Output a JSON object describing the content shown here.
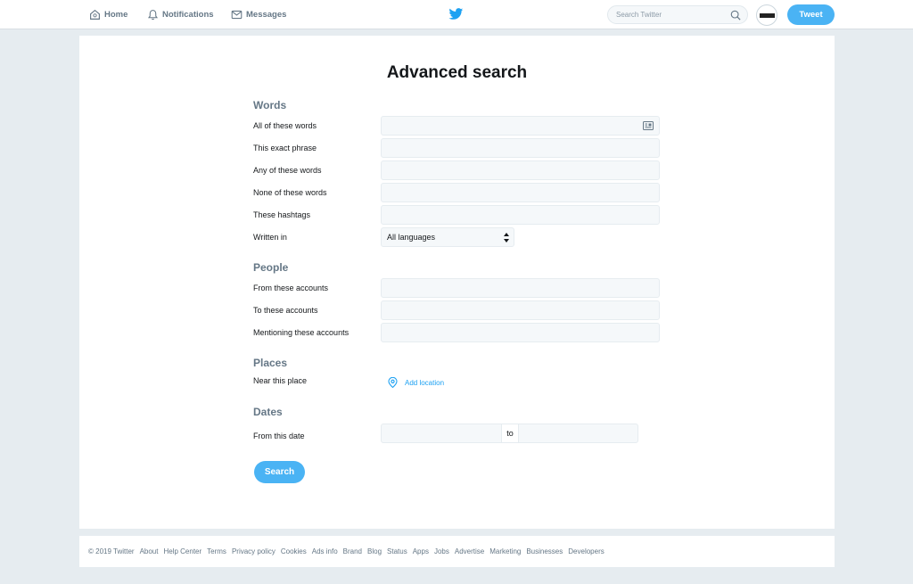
{
  "nav": {
    "home_label": "Home",
    "notifications_label": "Notifications",
    "messages_label": "Messages",
    "search_placeholder": "Search Twitter",
    "tweet_label": "Tweet"
  },
  "page": {
    "title": "Advanced search"
  },
  "words": {
    "title": "Words",
    "all_label": "All of these words",
    "exact_label": "This exact phrase",
    "any_label": "Any of these words",
    "none_label": "None of these words",
    "hashtags_label": "These hashtags",
    "written_label": "Written in",
    "language_value": "All languages"
  },
  "people": {
    "title": "People",
    "from_label": "From these accounts",
    "to_label": "To these accounts",
    "mentioning_label": "Mentioning these accounts"
  },
  "places": {
    "title": "Places",
    "near_label": "Near this place",
    "add_location": "Add location"
  },
  "dates": {
    "title": "Dates",
    "from_label": "From this date",
    "to_word": "to"
  },
  "search_button": "Search",
  "footer": [
    "© 2019 Twitter",
    "About",
    "Help Center",
    "Terms",
    "Privacy policy",
    "Cookies",
    "Ads info",
    "Brand",
    "Blog",
    "Status",
    "Apps",
    "Jobs",
    "Advertise",
    "Marketing",
    "Businesses",
    "Developers"
  ],
  "colors": {
    "accent": "#4ab3f4",
    "link": "#1da1f2",
    "background": "#e6ecf0",
    "muted_text": "#657786"
  },
  "icons": [
    "home-icon",
    "bell-icon",
    "envelope-icon",
    "twitter-bird-icon",
    "search-icon",
    "keyboard-icon",
    "select-arrows-icon",
    "location-pin-icon"
  ]
}
